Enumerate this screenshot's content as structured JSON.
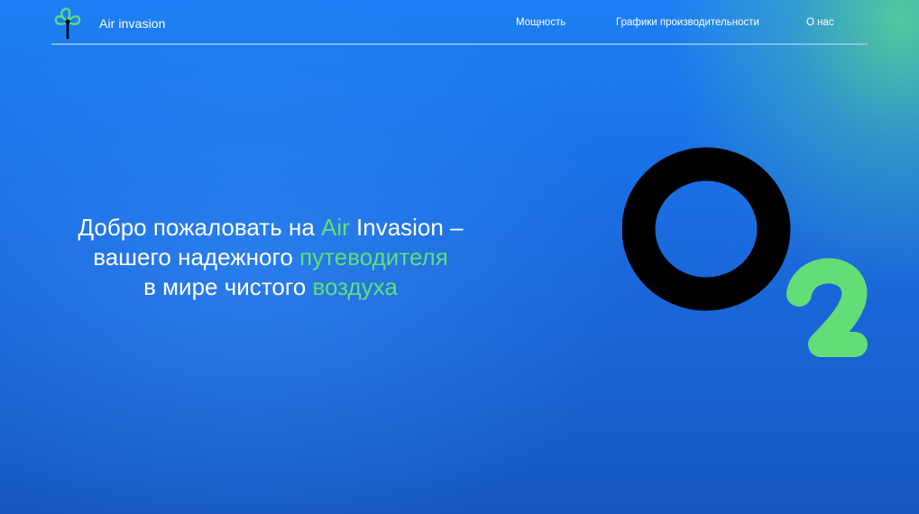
{
  "header": {
    "brand": "Air invasion",
    "logo_icon": "fan-icon",
    "nav": [
      {
        "label": "Мощность"
      },
      {
        "label": "Графики производительности"
      },
      {
        "label": "О нас"
      }
    ]
  },
  "hero": {
    "line1_pre": "Добро пожаловать на ",
    "line1_accent": "Air",
    "line1_post": " Invasion –",
    "line2_pre": "вашего надежного ",
    "line2_accent": "путеводителя",
    "line3_pre": "в мире чистого ",
    "line3_accent": "воздуха"
  },
  "illustration": {
    "letter": "O",
    "subscript": "2",
    "icon": "o2-molecule-graphic"
  },
  "colors": {
    "accent_green": "#63de77",
    "background_blue": "#1a6fe4",
    "corner_green": "#5cd68c",
    "text_white": "#ffffff",
    "o_black": "#000000"
  }
}
